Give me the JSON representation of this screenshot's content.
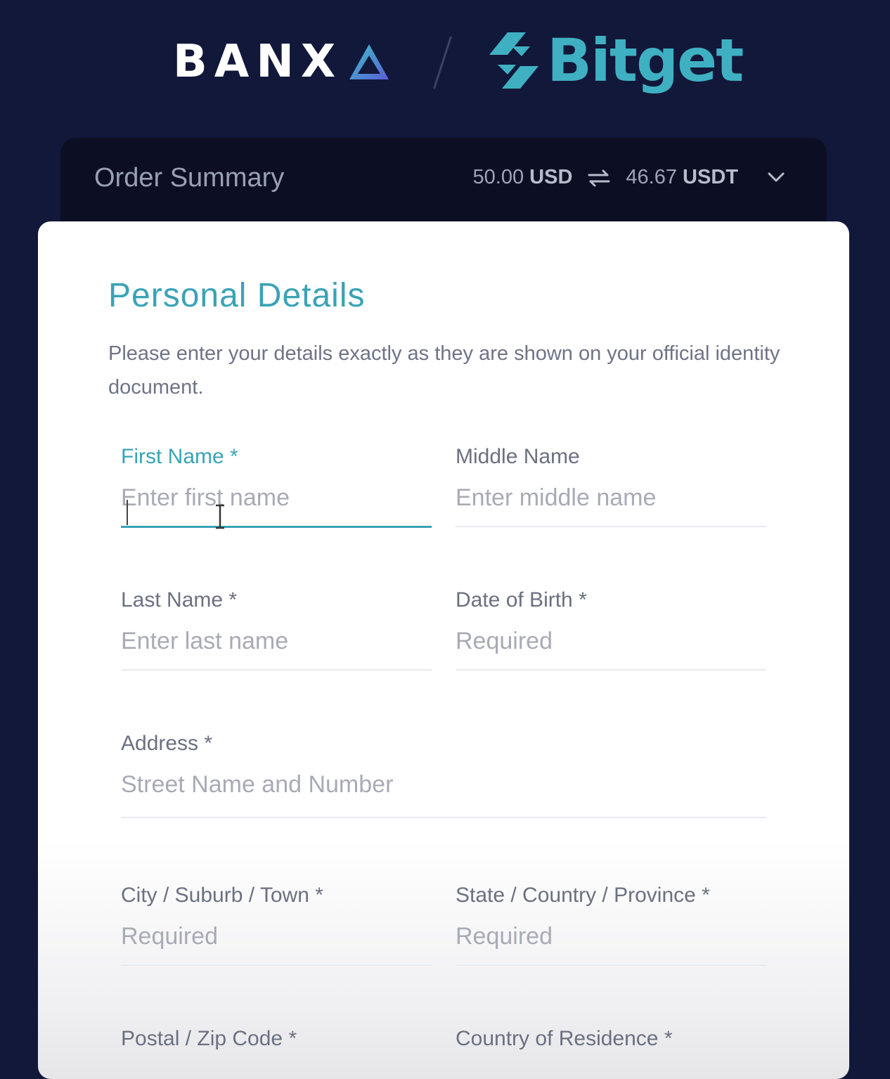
{
  "header": {
    "banxa_logo_text": "BANX",
    "bitget_logo_text": "Bitget"
  },
  "order_summary": {
    "title": "Order Summary",
    "from_amount": "50.00",
    "from_currency": "USD",
    "to_amount": "46.67",
    "to_currency": "USDT"
  },
  "form": {
    "title": "Personal Details",
    "description": "Please enter your details exactly as they are shown on your official identity document.",
    "fields": {
      "first_name": {
        "label": "First Name *",
        "placeholder": "Enter first name"
      },
      "middle_name": {
        "label": "Middle Name",
        "placeholder": "Enter middle name"
      },
      "last_name": {
        "label": "Last Name *",
        "placeholder": "Enter last name"
      },
      "dob": {
        "label": "Date of Birth *",
        "placeholder": "Required"
      },
      "address": {
        "label": "Address *",
        "placeholder": "Street Name and Number"
      },
      "city": {
        "label": "City / Suburb / Town *",
        "placeholder": "Required"
      },
      "state": {
        "label": "State / Country / Province *",
        "placeholder": "Required"
      },
      "postal": {
        "label": "Postal / Zip Code *"
      },
      "country": {
        "label": "Country of Residence *"
      }
    }
  },
  "colors": {
    "background": "#12183a",
    "accent": "#3aa3b6",
    "bitget_brand": "#3fb0c2",
    "summary_bar": "#0c0f24"
  }
}
